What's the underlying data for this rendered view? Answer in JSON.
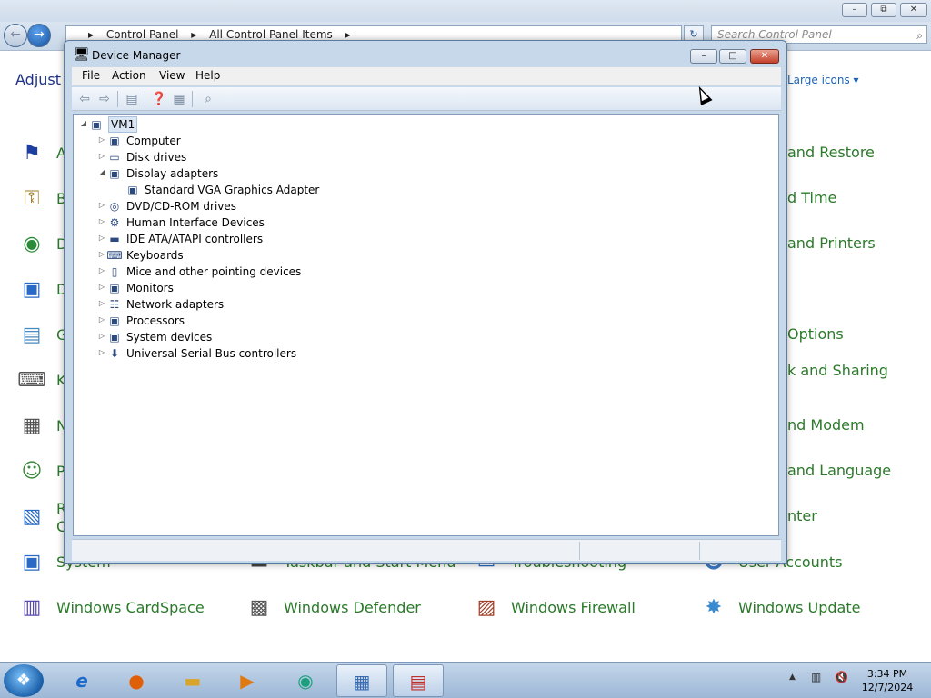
{
  "control_panel": {
    "address": {
      "crumbs": [
        "Control Panel",
        "All Control Panel Items"
      ]
    },
    "search": {
      "placeholder": "Search Control Panel"
    },
    "heading": "Adjust y",
    "view_by": "Large icons ▾",
    "left_items": [
      {
        "label": "A",
        "icon": "action-center-flag-icon",
        "glyph": "⚑"
      },
      {
        "label": "B",
        "icon": "bitlocker-key-icon",
        "glyph": "⚿"
      },
      {
        "label": "D",
        "icon": "default-programs-icon",
        "glyph": "◉"
      },
      {
        "label": "D",
        "icon": "display-monitor-icon",
        "glyph": "▣"
      },
      {
        "label": "G",
        "icon": "gadgets-icon",
        "glyph": "▤"
      },
      {
        "label": "K",
        "icon": "keyboard-icon",
        "glyph": "⌨"
      },
      {
        "label": "N",
        "icon": "notification-icon",
        "glyph": "▦"
      },
      {
        "label": "P",
        "icon": "parental-controls-icon",
        "glyph": "☺"
      },
      {
        "label": "R",
        "label2": "C",
        "icon": "remote-connections-icon",
        "glyph": "▧"
      },
      {
        "label": "System",
        "icon": "system-icon",
        "glyph": "▣"
      },
      {
        "label": "Windows CardSpace",
        "icon": "cardspace-icon",
        "glyph": "▥"
      }
    ],
    "mid_items": [
      {
        "label": "Taskbar and Start Menu",
        "icon": "taskbar-icon",
        "glyph": "▬"
      },
      {
        "label": "Windows Defender",
        "icon": "defender-icon",
        "glyph": "▩"
      }
    ],
    "mid2_items": [
      {
        "label": "Troubleshooting",
        "icon": "troubleshooting-icon",
        "glyph": "▭"
      },
      {
        "label": "Windows Firewall",
        "icon": "firewall-icon",
        "glyph": "▨"
      }
    ],
    "right_items": [
      {
        "label": "and Restore"
      },
      {
        "label": "d Time"
      },
      {
        "label": "and Printers"
      },
      {
        "label": "Options"
      },
      {
        "label": "k and Sharing"
      },
      {
        "label": "nd Modem"
      },
      {
        "label": "and Language"
      },
      {
        "label": "nter"
      },
      {
        "label": "User Accounts",
        "icon": "user-accounts-icon",
        "glyph": "☻"
      },
      {
        "label": "Windows Update",
        "icon": "windows-update-icon",
        "glyph": "✸"
      }
    ]
  },
  "device_manager": {
    "title": "Device Manager",
    "menu": [
      "File",
      "Action",
      "View",
      "Help"
    ],
    "tree": {
      "root": "VM1",
      "children": [
        {
          "label": "Computer",
          "expanded": false,
          "icon": "computer-icon",
          "glyph": "▣"
        },
        {
          "label": "Disk drives",
          "expanded": false,
          "icon": "disk-drive-icon",
          "glyph": "▭"
        },
        {
          "label": "Display adapters",
          "expanded": true,
          "icon": "display-adapter-icon",
          "glyph": "▣",
          "children": [
            {
              "label": "Standard VGA Graphics Adapter",
              "icon": "vga-adapter-icon",
              "glyph": "▣"
            }
          ]
        },
        {
          "label": "DVD/CD-ROM drives",
          "expanded": false,
          "icon": "dvd-drive-icon",
          "glyph": "◎"
        },
        {
          "label": "Human Interface Devices",
          "expanded": false,
          "icon": "hid-icon",
          "glyph": "⚙"
        },
        {
          "label": "IDE ATA/ATAPI controllers",
          "expanded": false,
          "icon": "ide-controller-icon",
          "glyph": "▬"
        },
        {
          "label": "Keyboards",
          "expanded": false,
          "icon": "keyboard-icon",
          "glyph": "⌨"
        },
        {
          "label": "Mice and other pointing devices",
          "expanded": false,
          "icon": "mouse-icon",
          "glyph": "▯"
        },
        {
          "label": "Monitors",
          "expanded": false,
          "icon": "monitor-icon",
          "glyph": "▣"
        },
        {
          "label": "Network adapters",
          "expanded": false,
          "icon": "network-adapter-icon",
          "glyph": "☷"
        },
        {
          "label": "Processors",
          "expanded": false,
          "icon": "processor-icon",
          "glyph": "▣"
        },
        {
          "label": "System devices",
          "expanded": false,
          "icon": "system-devices-icon",
          "glyph": "▣"
        },
        {
          "label": "Universal Serial Bus controllers",
          "expanded": false,
          "icon": "usb-icon",
          "glyph": "⬇"
        }
      ]
    }
  },
  "taskbar": {
    "apps": [
      {
        "name": "internet-explorer",
        "icon": "ie-icon",
        "glyph": "e"
      },
      {
        "name": "firefox",
        "icon": "firefox-icon",
        "glyph": "●"
      },
      {
        "name": "explorer",
        "icon": "folder-icon",
        "glyph": "▬"
      },
      {
        "name": "media-player",
        "icon": "media-player-icon",
        "glyph": "▶"
      },
      {
        "name": "app5",
        "icon": "app-icon",
        "glyph": "◉"
      },
      {
        "name": "control-panel",
        "icon": "control-panel-icon",
        "glyph": "▦",
        "active": true
      },
      {
        "name": "device-manager",
        "icon": "toolbox-icon",
        "glyph": "▤",
        "active": true
      }
    ],
    "time": "3:34 PM",
    "date": "12/7/2024"
  }
}
